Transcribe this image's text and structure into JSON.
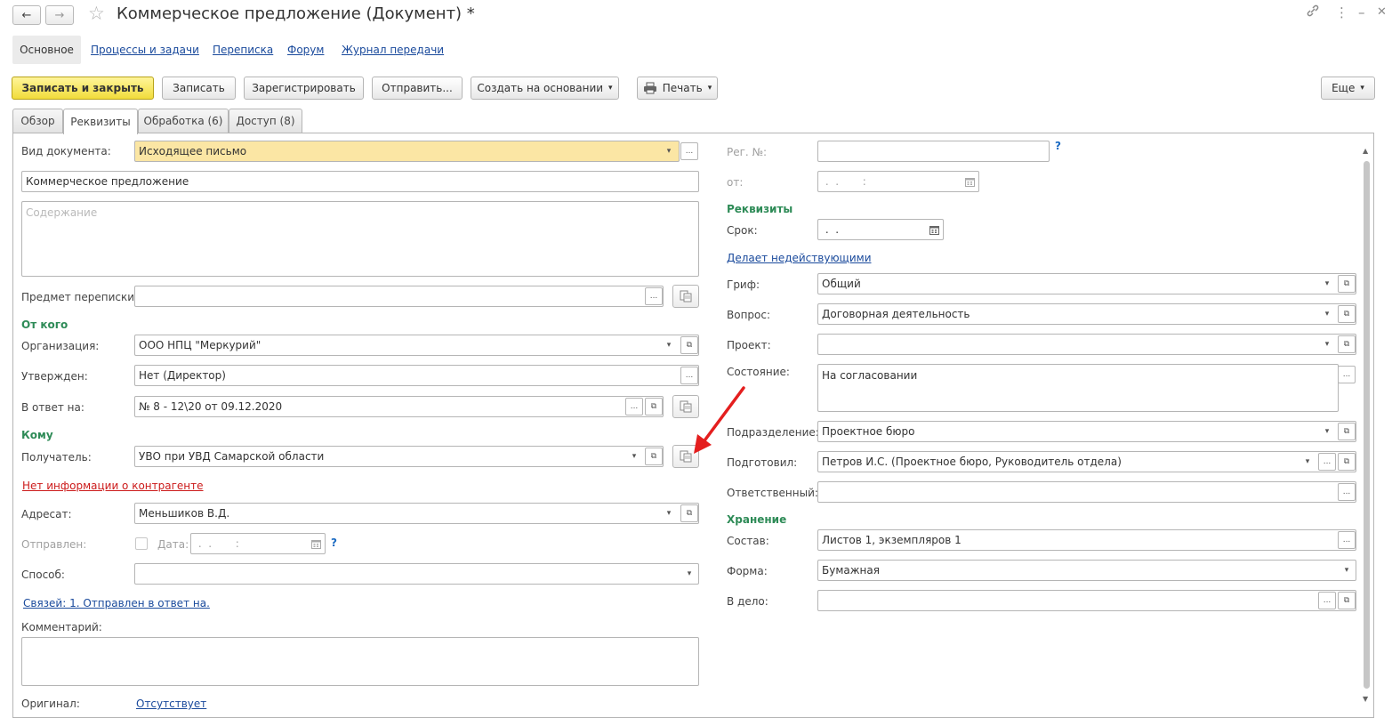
{
  "window": {
    "title": "Коммерческое предложение (Документ) *",
    "back_icon": "←",
    "forward_icon": "→",
    "star_icon": "☆",
    "link_icon": "🔗",
    "menu_icon": "⋮",
    "minimize_icon": "–",
    "close_icon": "✕"
  },
  "nav_tabs": [
    "Основное",
    "Процессы и задачи",
    "Переписка",
    "Форум",
    "Журнал передачи"
  ],
  "toolbar": {
    "save_close": "Записать и закрыть",
    "save": "Записать",
    "register": "Зарегистрировать",
    "send": "Отправить...",
    "create_based": "Создать на основании",
    "print": "Печать",
    "more": "Еще"
  },
  "tabs": [
    "Обзор",
    "Реквизиты",
    "Обработка (6)",
    "Доступ (8)"
  ],
  "left": {
    "doc_type_label": "Вид документа:",
    "doc_type_value": "Исходящее письмо",
    "title_value": "Коммерческое предложение",
    "content_placeholder": "Содержание",
    "subject_label": "Предмет переписки:",
    "subject_value": "",
    "from_section": "От кого",
    "org_label": "Организация:",
    "org_value": "ООО НПЦ \"Меркурий\"",
    "approved_label": "Утвержден:",
    "approved_value": "Нет (Директор)",
    "reply_label": "В ответ на:",
    "reply_value": "№ 8 - 12\\20 от 09.12.2020",
    "to_section": "Кому",
    "recipient_label": "Получатель:",
    "recipient_value": "УВО при УВД Самарской области",
    "no_info_link": "Нет информации о контрагенте",
    "addressee_label": "Адресат:",
    "addressee_value": "Меньшиков В.Д.",
    "sent_label": "Отправлен:",
    "date_label": "Дата:",
    "date_value": " .  .       :",
    "method_label": "Способ:",
    "method_value": "",
    "links_link": "Связей: 1. Отправлен в ответ на.",
    "comment_label": "Комментарий:",
    "original_label": "Оригинал:",
    "original_link": "Отсутствует"
  },
  "right": {
    "reg_no_label": "Рег. №:",
    "reg_no_value": "",
    "from_label": "от:",
    "from_value": " .  .       :",
    "requisites_section": "Реквизиты",
    "deadline_label": "Срок:",
    "deadline_value": " .  .",
    "invalidates_link": "Делает недействующими",
    "grif_label": "Гриф:",
    "grif_value": "Общий",
    "question_label": "Вопрос:",
    "question_value": "Договорная деятельность",
    "project_label": "Проект:",
    "project_value": "",
    "state_label": "Состояние:",
    "state_value": "На согласовании",
    "division_label": "Подразделение:",
    "division_value": "Проектное бюро",
    "prepared_label": "Подготовил:",
    "prepared_value": "Петров И.С. (Проектное бюро, Руководитель отдела)",
    "responsible_label": "Ответственный:",
    "responsible_value": "",
    "storage_section": "Хранение",
    "composition_label": "Состав:",
    "composition_value": "Листов 1, экземпляров 1",
    "form_label": "Форма:",
    "form_value": "Бумажная",
    "case_label": "В дело:",
    "case_value": ""
  },
  "glyphs": {
    "dropdown": "▾",
    "ellipsis": "...",
    "open": "⧉",
    "help": "?",
    "calendar": "▦"
  },
  "colors": {
    "primary_button": "#f1dc3b",
    "section_green": "#2e8b57",
    "link_blue": "#1a4a9c",
    "link_red": "#cc1b1b",
    "highlight_field": "#fbe6a4",
    "arrow_red": "#e41e1e"
  }
}
